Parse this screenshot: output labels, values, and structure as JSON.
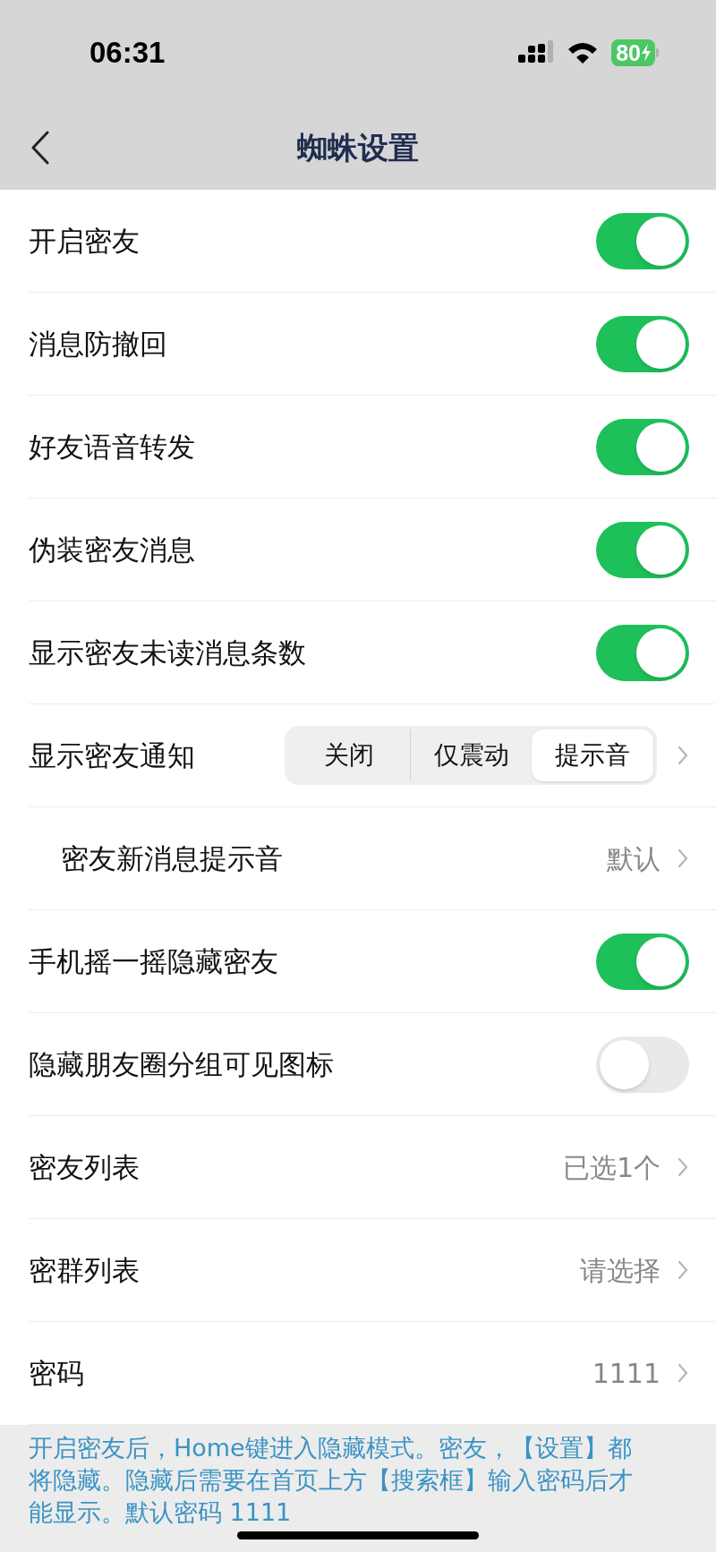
{
  "status_bar": {
    "time": "06:31",
    "battery": "80"
  },
  "nav": {
    "title": "蜘蛛设置"
  },
  "rows": [
    {
      "kind": "toggle",
      "label": "开启密友",
      "on": true
    },
    {
      "kind": "toggle",
      "label": "消息防撤回",
      "on": true
    },
    {
      "kind": "toggle",
      "label": "好友语音转发",
      "on": true
    },
    {
      "kind": "toggle",
      "label": "伪装密友消息",
      "on": true
    },
    {
      "kind": "toggle",
      "label": "显示密友未读消息条数",
      "on": true
    },
    {
      "kind": "segmented",
      "label": "显示密友通知",
      "options": [
        {
          "label": "关闭",
          "selected": false
        },
        {
          "label": "仅震动",
          "selected": false
        },
        {
          "label": "提示音",
          "selected": true
        }
      ]
    },
    {
      "kind": "value",
      "label": "密友新消息提示音",
      "value": "默认",
      "indented": true
    },
    {
      "kind": "toggle",
      "label": "手机摇一摇隐藏密友",
      "on": true
    },
    {
      "kind": "toggle",
      "label": "隐藏朋友圈分组可见图标",
      "on": false
    },
    {
      "kind": "value",
      "label": "密友列表",
      "value": "已选1个",
      "indented": false
    },
    {
      "kind": "value",
      "label": "密群列表",
      "value": "请选择",
      "indented": false
    },
    {
      "kind": "value",
      "label": "密码",
      "value": "1111",
      "indented": false
    }
  ],
  "footer": {
    "note": "开启密友后，Home键进入隐藏模式。密友，【设置】都将隐藏。隐藏后需要在首页上方【搜索框】输入密码后才能显示。默认密码 1111"
  }
}
